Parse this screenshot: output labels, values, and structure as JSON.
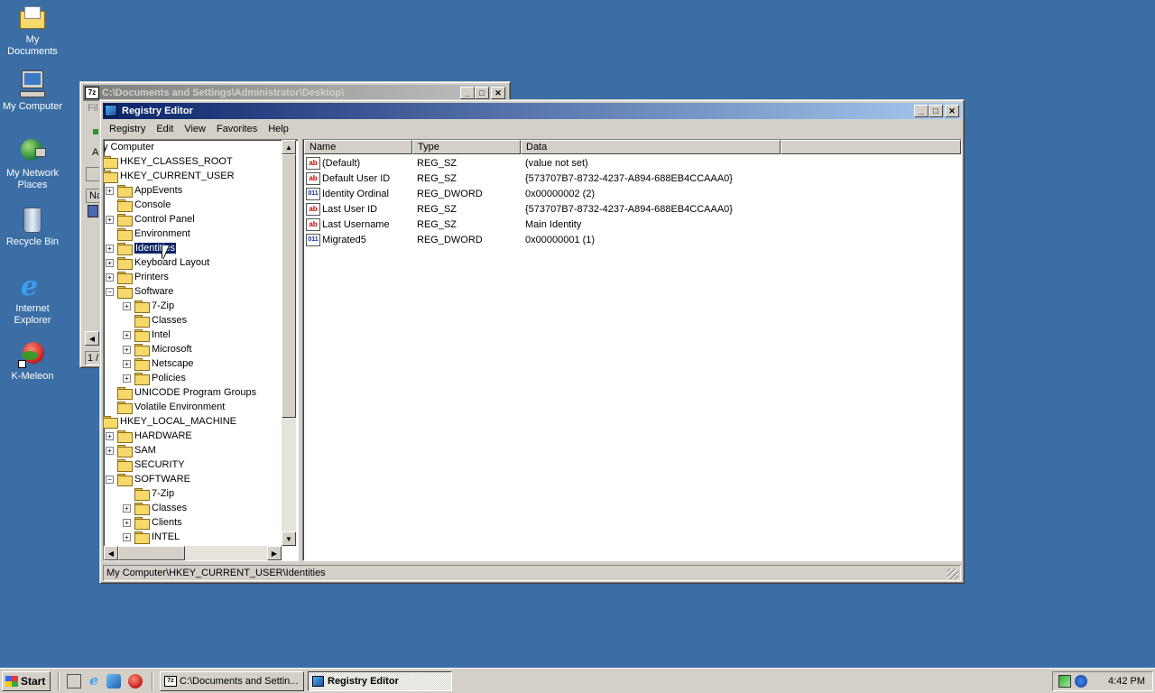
{
  "desktop": {
    "icons": [
      {
        "label": "My Documents"
      },
      {
        "label": "My Computer"
      },
      {
        "label": "My Network Places"
      },
      {
        "label": "Recycle Bin"
      },
      {
        "label": "Internet Explorer"
      },
      {
        "label": "K-Meleon"
      }
    ]
  },
  "bg_window": {
    "title": "C:\\Documents and Settings\\Administrator\\Desktop\\",
    "icon_text": "7z",
    "frag_menu": "Fil",
    "frag_a": "A",
    "frag_na": "Na",
    "frag_status": "1 /"
  },
  "regedit": {
    "title": "Registry Editor",
    "menu": [
      "Registry",
      "Edit",
      "View",
      "Favorites",
      "Help"
    ],
    "tree": [
      {
        "label": "y Computer",
        "level": 0,
        "exp": ""
      },
      {
        "label": "HKEY_CLASSES_ROOT",
        "level": 0,
        "exp": "+"
      },
      {
        "label": "HKEY_CURRENT_USER",
        "level": 0,
        "exp": "-"
      },
      {
        "label": "AppEvents",
        "level": 1,
        "exp": "+"
      },
      {
        "label": "Console",
        "level": 1,
        "exp": ""
      },
      {
        "label": "Control Panel",
        "level": 1,
        "exp": "+"
      },
      {
        "label": "Environment",
        "level": 1,
        "exp": ""
      },
      {
        "label": "Identities",
        "level": 1,
        "exp": "+",
        "selected": true
      },
      {
        "label": "Keyboard Layout",
        "level": 1,
        "exp": "+"
      },
      {
        "label": "Printers",
        "level": 1,
        "exp": "+"
      },
      {
        "label": "Software",
        "level": 1,
        "exp": "-"
      },
      {
        "label": "7-Zip",
        "level": 2,
        "exp": "+"
      },
      {
        "label": "Classes",
        "level": 2,
        "exp": ""
      },
      {
        "label": "Intel",
        "level": 2,
        "exp": "+"
      },
      {
        "label": "Microsoft",
        "level": 2,
        "exp": "+"
      },
      {
        "label": "Netscape",
        "level": 2,
        "exp": "+"
      },
      {
        "label": "Policies",
        "level": 2,
        "exp": "+"
      },
      {
        "label": "UNICODE Program Groups",
        "level": 1,
        "exp": ""
      },
      {
        "label": "Volatile Environment",
        "level": 1,
        "exp": ""
      },
      {
        "label": "HKEY_LOCAL_MACHINE",
        "level": 0,
        "exp": "-"
      },
      {
        "label": "HARDWARE",
        "level": 1,
        "exp": "+"
      },
      {
        "label": "SAM",
        "level": 1,
        "exp": "+"
      },
      {
        "label": "SECURITY",
        "level": 1,
        "exp": ""
      },
      {
        "label": "SOFTWARE",
        "level": 1,
        "exp": "-"
      },
      {
        "label": "7-Zip",
        "level": 2,
        "exp": ""
      },
      {
        "label": "Classes",
        "level": 2,
        "exp": "+"
      },
      {
        "label": "Clients",
        "level": 2,
        "exp": "+"
      },
      {
        "label": "INTEL",
        "level": 2,
        "exp": "+"
      }
    ],
    "columns": [
      "Name",
      "Type",
      "Data"
    ],
    "values": [
      {
        "name": "(Default)",
        "type": "REG_SZ",
        "data": "(value not set)",
        "icon": "ab"
      },
      {
        "name": "Default User ID",
        "type": "REG_SZ",
        "data": "{573707B7-8732-4237-A894-688EB4CCAAA0}",
        "icon": "ab"
      },
      {
        "name": "Identity Ordinal",
        "type": "REG_DWORD",
        "data": "0x00000002 (2)",
        "icon": "dw"
      },
      {
        "name": "Last User ID",
        "type": "REG_SZ",
        "data": "{573707B7-8732-4237-A894-688EB4CCAAA0}",
        "icon": "ab"
      },
      {
        "name": "Last Username",
        "type": "REG_SZ",
        "data": "Main Identity",
        "icon": "ab"
      },
      {
        "name": "Migrated5",
        "type": "REG_DWORD",
        "data": "0x00000001 (1)",
        "icon": "dw"
      }
    ],
    "status": "My Computer\\HKEY_CURRENT_USER\\Identities"
  },
  "taskbar": {
    "start": "Start",
    "tasks": [
      {
        "label": "C:\\Documents and Settin...",
        "active": false
      },
      {
        "label": "Registry Editor",
        "active": true
      }
    ],
    "clock": "4:42 PM"
  },
  "colors": {
    "desktop": "#3a6ea5",
    "title_active": "#0a246a",
    "face": "#d4d0c8"
  }
}
